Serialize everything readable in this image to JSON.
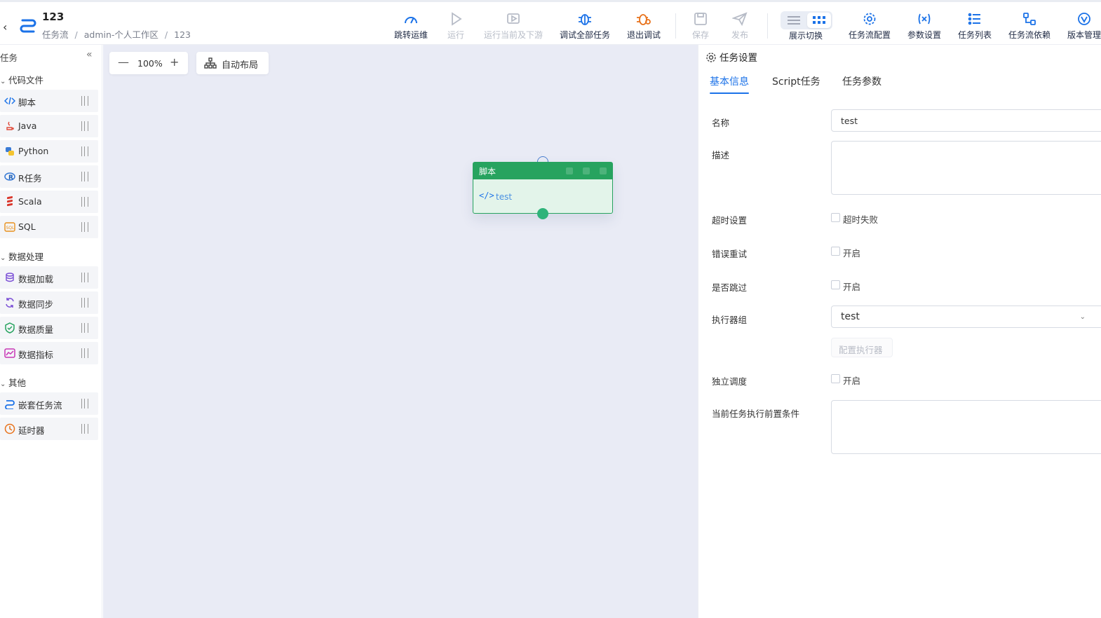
{
  "header": {
    "back_icon": "chevron-left-icon",
    "title": "123",
    "breadcrumbs": [
      "任务流",
      "admin-个人工作区",
      "123"
    ],
    "toolbar": [
      {
        "label": "跳转运维",
        "icon": "gauge-icon",
        "state": "enabled"
      },
      {
        "label": "运行",
        "icon": "play-icon",
        "state": "disabled"
      },
      {
        "label": "运行当前及下游",
        "icon": "play-downstream-icon",
        "state": "disabled"
      },
      {
        "label": "调试全部任务",
        "icon": "bug-icon",
        "state": "enabled"
      },
      {
        "label": "退出调试",
        "icon": "bug-exit-icon",
        "state": "enabled"
      },
      {
        "label": "保存",
        "icon": "save-icon",
        "state": "disabled"
      },
      {
        "label": "发布",
        "icon": "send-icon",
        "state": "disabled"
      },
      {
        "label": "展示切换",
        "icon": "view-toggle-icon",
        "state": "enabled"
      },
      {
        "label": "任务流配置",
        "icon": "gear-icon",
        "state": "enabled"
      },
      {
        "label": "参数设置",
        "icon": "variable-icon",
        "state": "enabled"
      },
      {
        "label": "任务列表",
        "icon": "list-icon",
        "state": "enabled"
      },
      {
        "label": "任务流依赖",
        "icon": "dependency-icon",
        "state": "enabled"
      },
      {
        "label": "版本管理",
        "icon": "version-icon",
        "state": "enabled"
      }
    ]
  },
  "sidebar": {
    "title": "任务",
    "groups": [
      {
        "label": "代码文件",
        "items": [
          {
            "label": "脚本",
            "icon": "code-icon"
          },
          {
            "label": "Java",
            "icon": "java-icon"
          },
          {
            "label": "Python",
            "icon": "python-icon"
          },
          {
            "label": "R任务",
            "icon": "r-icon"
          },
          {
            "label": "Scala",
            "icon": "scala-icon"
          },
          {
            "label": "SQL",
            "icon": "sql-icon"
          }
        ]
      },
      {
        "label": "数据处理",
        "items": [
          {
            "label": "数据加载",
            "icon": "database-icon"
          },
          {
            "label": "数据同步",
            "icon": "sync-icon"
          },
          {
            "label": "数据质量",
            "icon": "shield-check-icon"
          },
          {
            "label": "数据指标",
            "icon": "trend-chart-icon"
          }
        ]
      },
      {
        "label": "其他",
        "items": [
          {
            "label": "嵌套任务流",
            "icon": "nested-flow-icon"
          },
          {
            "label": "延时器",
            "icon": "clock-icon"
          }
        ]
      }
    ]
  },
  "canvas": {
    "zoom": "100%",
    "auto_layout": "自动布局",
    "node": {
      "header": "脚本",
      "name": "test"
    }
  },
  "panel": {
    "title": "任务设置",
    "tabs": [
      "基本信息",
      "Script任务",
      "任务参数"
    ],
    "active_tab": 0,
    "fields": {
      "name_label": "名称",
      "name_value": "test",
      "desc_label": "描述",
      "desc_value": "",
      "timeout_label": "超时设置",
      "timeout_option": "超时失败",
      "retry_label": "错误重试",
      "retry_option": "开启",
      "skip_label": "是否跳过",
      "skip_option": "开启",
      "executor_label": "执行器组",
      "executor_value": "test",
      "executor_button": "配置执行器",
      "independent_label": "独立调度",
      "independent_option": "开启",
      "precondition_label": "当前任务执行前置条件",
      "precondition_value": ""
    }
  },
  "colors": {
    "accent": "#1b72e8",
    "node_green": "#27a35f",
    "canvas_bg": "#e9ebf5",
    "warning": "#e8721b"
  }
}
